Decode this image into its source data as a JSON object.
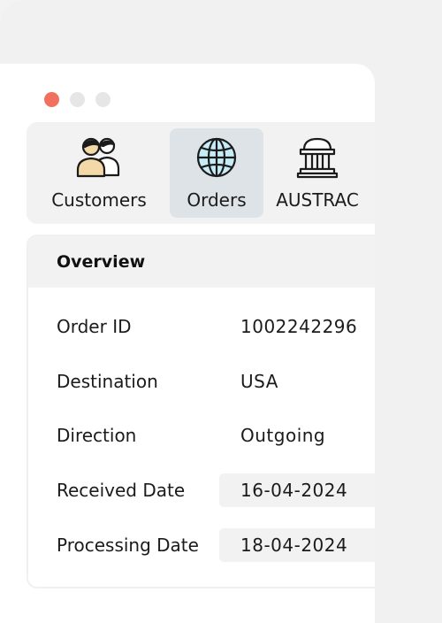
{
  "tabs": [
    {
      "label": "Customers",
      "icon": "customers-icon",
      "active": false
    },
    {
      "label": "Orders",
      "icon": "globe-icon",
      "active": true
    },
    {
      "label": "AUSTRAC",
      "icon": "bank-building-icon",
      "active": false
    }
  ],
  "overview": {
    "title": "Overview",
    "rows": [
      {
        "label": "Order ID",
        "value": "1002242296"
      },
      {
        "label": "Destination",
        "value": "USA"
      },
      {
        "label": "Direction",
        "value": "Outgoing"
      },
      {
        "label": "Received Date",
        "value": "16-04-2024"
      },
      {
        "label": "Processing Date",
        "value": "18-04-2024"
      }
    ]
  },
  "colors": {
    "close_dot": "#f2705e",
    "active_tab": "#dde3e7",
    "globe_fill": "#c6ecf7",
    "avatar_skin": "#f3d9a8"
  }
}
